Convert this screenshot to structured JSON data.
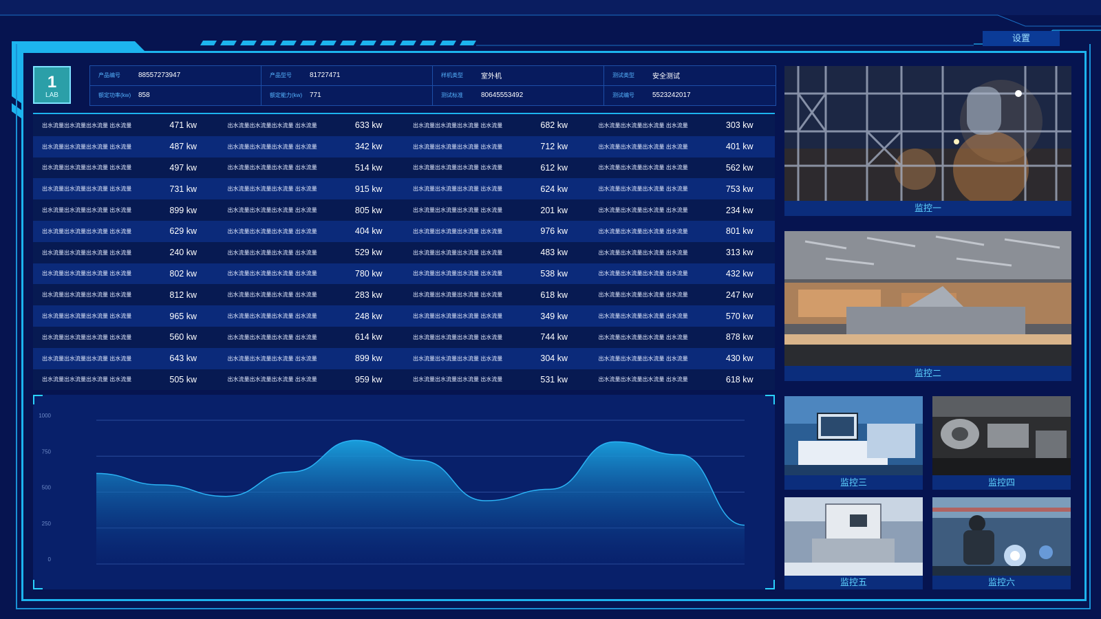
{
  "header": {
    "settings_label": "设置"
  },
  "lab": {
    "number": "1",
    "label": "LAB"
  },
  "info": [
    {
      "label": "产品编号",
      "value": "88557273947"
    },
    {
      "label": "产品型号",
      "value": "81727471"
    },
    {
      "label": "样机类型",
      "value": "室外机"
    },
    {
      "label": "测试类型",
      "value": "安全测试"
    },
    {
      "label": "额定功率(kw)",
      "value": "858"
    },
    {
      "label": "额定能力(kw)",
      "value": "771"
    },
    {
      "label": "测试标准",
      "value": "80645553492"
    },
    {
      "label": "测试编号",
      "value": "5523242017"
    }
  ],
  "table": {
    "row_label": "出水流量出水流量出水流量 出水流量",
    "rows": [
      [
        "471 kw",
        "633 kw",
        "682 kw",
        "303 kw"
      ],
      [
        "487 kw",
        "342 kw",
        "712 kw",
        "401 kw"
      ],
      [
        "497 kw",
        "514 kw",
        "612 kw",
        "562 kw"
      ],
      [
        "731 kw",
        "915 kw",
        "624 kw",
        "753 kw"
      ],
      [
        "899 kw",
        "805 kw",
        "201 kw",
        "234 kw"
      ],
      [
        "629 kw",
        "404 kw",
        "976 kw",
        "801 kw"
      ],
      [
        "240 kw",
        "529 kw",
        "483 kw",
        "313 kw"
      ],
      [
        "802 kw",
        "780 kw",
        "538 kw",
        "432 kw"
      ],
      [
        "812 kw",
        "283 kw",
        "618 kw",
        "247 kw"
      ],
      [
        "965 kw",
        "248 kw",
        "349 kw",
        "570 kw"
      ],
      [
        "560 kw",
        "614 kw",
        "744 kw",
        "878 kw"
      ],
      [
        "643 kw",
        "899 kw",
        "304 kw",
        "430 kw"
      ],
      [
        "505 kw",
        "959 kw",
        "531 kw",
        "618 kw"
      ]
    ]
  },
  "chart_data": {
    "type": "area",
    "ylim": [
      0,
      1000
    ],
    "yticks": [
      "1000",
      "750",
      "500",
      "250",
      "0"
    ],
    "values": [
      630,
      550,
      470,
      640,
      860,
      720,
      440,
      520,
      850,
      760,
      270
    ],
    "colors": {
      "line": "#2bb3f5",
      "fill_top": "#1aa3e0",
      "fill_bottom": "#0a2a7a",
      "grid": "#2a4c9c"
    }
  },
  "monitors": [
    {
      "label": "监控一",
      "scene": "refinery"
    },
    {
      "label": "监控二",
      "scene": "warehouse"
    },
    {
      "label": "监控三",
      "scene": "workstation"
    },
    {
      "label": "监控四",
      "scene": "lathe"
    },
    {
      "label": "监控五",
      "scene": "machine"
    },
    {
      "label": "监控六",
      "scene": "welding"
    }
  ]
}
